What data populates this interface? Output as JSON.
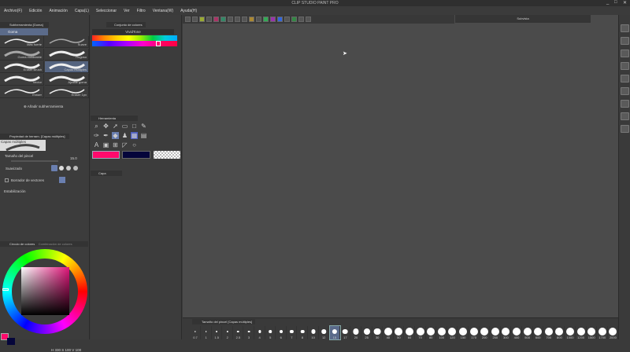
{
  "window": {
    "title": "CLIP STUDIO PAINT PRO",
    "min": "_",
    "max": "□",
    "close": "✕"
  },
  "menu": [
    "Archivo(F)",
    "Edición",
    "Animación",
    "Capa(L)",
    "Seleccionar",
    "Ver",
    "Filtro",
    "Ventana(W)",
    "Ayuda(H)"
  ],
  "subtool_panel": {
    "title": "Subherramienta [Goma]",
    "group": "Goma",
    "brushes": [
      "Más fuerte",
      "Suave",
      "Goma moldeable",
      "Rugoso",
      "Eraser Brush",
      "Capas múltiples",
      "Vector",
      "Ajustar goma",
      "Eraser",
      "Eraser 1px"
    ],
    "selected": "Capas múltiples",
    "add_label": "Añadir subherramienta"
  },
  "tool_property": {
    "title": "Propiedad de herram. [Capas múltiples]",
    "preview_label": "Capas múltiples",
    "brush_size_label": "Tamaño del pincel",
    "brush_size_value": "15.0",
    "smoothing_label": "Suavizado",
    "vector_eraser_label": "Borrador de vectores",
    "stabilization_label": "Estabilización"
  },
  "color_panel": {
    "tab1": "Círculo de colores",
    "tab2": "Combinación de colores",
    "h": "330",
    "s": "100",
    "v": "100",
    "main_color": "#ff0a6c",
    "sub_color": "#05053a"
  },
  "color_set": {
    "title": "Conjunto de colores",
    "set_name": "VividTone"
  },
  "tool_panel": {
    "title": "Herramienta",
    "main_color": "#ff0a6c",
    "sub_color": "#05053a"
  },
  "layer_panel": {
    "title": "Capa"
  },
  "subview": {
    "title": "Subvista"
  },
  "brush_size": {
    "title": "Tamaño del pincel [Capas múltiples]",
    "sizes": [
      "0.7",
      "1",
      "1.5",
      "2",
      "2.5",
      "3",
      "4",
      "5",
      "6",
      "7",
      "8",
      "10",
      "12",
      "15",
      "17",
      "20",
      "25",
      "30",
      "40",
      "50",
      "60",
      "70",
      "80",
      "100",
      "120",
      "150",
      "170",
      "200",
      "250",
      "300",
      "400",
      "500",
      "600",
      "700",
      "800",
      "1000",
      "1200",
      "1500",
      "1700",
      "2000"
    ],
    "selected": "15"
  }
}
